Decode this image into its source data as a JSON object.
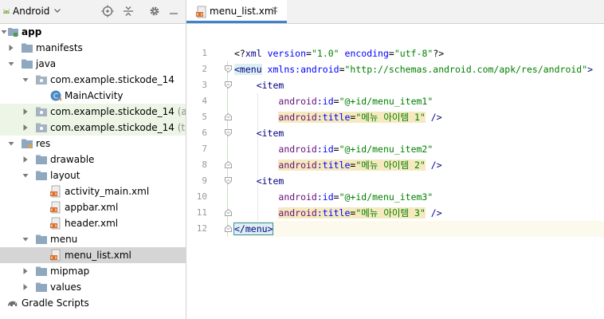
{
  "project_view": {
    "title": "Android",
    "colors": {
      "folder": "#8fa7bf",
      "green_row": "#edf5e6",
      "selected_row": "#d5d5d5"
    }
  },
  "tree": [
    {
      "label": "app",
      "bold": true,
      "icon": "module-folder-icon",
      "arrow": "expanded"
    },
    {
      "label": "manifests",
      "icon": "folder-icon",
      "arrow": "collapsed"
    },
    {
      "label": "java",
      "icon": "folder-icon",
      "arrow": "expanded"
    },
    {
      "label": "com.example.stickode_14",
      "icon": "package-icon",
      "arrow": "expanded"
    },
    {
      "label": "MainActivity",
      "icon": "kotlin-class-icon",
      "arrow": "none"
    },
    {
      "label": "com.example.stickode_14",
      "suffix": " (andr",
      "icon": "package-icon",
      "arrow": "collapsed",
      "green": true
    },
    {
      "label": "com.example.stickode_14",
      "suffix": " (test)",
      "icon": "package-icon",
      "arrow": "collapsed",
      "green": true
    },
    {
      "label": "res",
      "icon": "res-folder-icon",
      "arrow": "expanded"
    },
    {
      "label": "drawable",
      "icon": "folder-icon",
      "arrow": "collapsed"
    },
    {
      "label": "layout",
      "icon": "folder-icon",
      "arrow": "expanded"
    },
    {
      "label": "activity_main.xml",
      "icon": "xml-file-icon",
      "arrow": "none"
    },
    {
      "label": "appbar.xml",
      "icon": "xml-file-icon",
      "arrow": "none"
    },
    {
      "label": "header.xml",
      "icon": "xml-file-icon",
      "arrow": "none"
    },
    {
      "label": "menu",
      "icon": "folder-icon",
      "arrow": "expanded"
    },
    {
      "label": "menu_list.xml",
      "icon": "xml-file-icon",
      "arrow": "none",
      "selected": true
    },
    {
      "label": "mipmap",
      "icon": "folder-icon",
      "arrow": "collapsed"
    },
    {
      "label": "values",
      "icon": "folder-icon",
      "arrow": "collapsed"
    },
    {
      "label": "Gradle Scripts",
      "icon": "gradle-icon",
      "arrow": "none"
    }
  ],
  "editor": {
    "tab_label": "menu_list.xml",
    "tab_close": "×",
    "line_numbers": [
      "1",
      "2",
      "3",
      "4",
      "5",
      "6",
      "7",
      "8",
      "9",
      "10",
      "11",
      "12"
    ],
    "code": {
      "l1_open": "<?",
      "l1_xml": "xml",
      "l1_version_attr": " version",
      "l1_eq1": "=",
      "l1_version_val": "\"1.0\"",
      "l1_enc_attr": " encoding",
      "l1_eq2": "=",
      "l1_enc_val": "\"utf-8\"",
      "l1_close": "?>",
      "l2_tag": "<menu",
      "l2_ns": " xmlns:android",
      "l2_eq": "=",
      "l2_val": "\"http://schemas.android.com/apk/res/android\"",
      "l2_close": ">",
      "item_tag": "<item",
      "id_ns": "android",
      "id_attr": ":id",
      "eq": "=",
      "item1_id": "\"@+id/menu_item1\"",
      "item2_id": "\"@+id/menu_item2\"",
      "item3_id": "\"@+id/menu_item3\"",
      "title_ns": "android",
      "title_attr": ":title",
      "item1_title": "\"메뉴 아이템 1\"",
      "item2_title": "\"메뉴 아이템 2\"",
      "item3_title": "\"메뉴 아이템 3\"",
      "self_close": " />",
      "end_menu": "</menu>"
    }
  }
}
